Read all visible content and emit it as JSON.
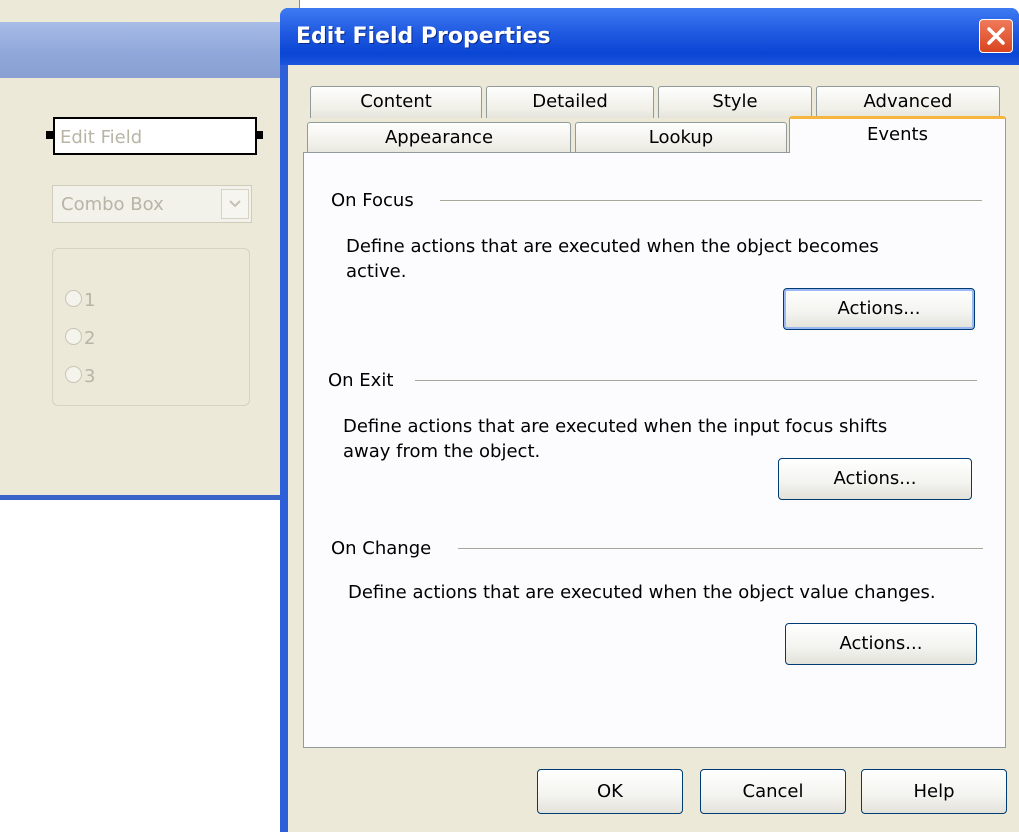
{
  "background_window": {
    "edit_field_label": "Edit Field",
    "combo_box_label": "Combo Box",
    "radio_options": [
      "1",
      "2",
      "3"
    ]
  },
  "dialog": {
    "title": "Edit Field Properties",
    "close_icon": "close-icon",
    "tabs_back_row": [
      "Content",
      "Detailed",
      "Style",
      "Advanced"
    ],
    "tabs_front_row": [
      "Appearance",
      "Lookup",
      "Events"
    ],
    "active_tab": "Events",
    "sections": [
      {
        "title": "On Focus",
        "description_line1": "Define actions that are executed when the object becomes",
        "description_line2": "active.",
        "button_label": "Actions..."
      },
      {
        "title": "On Exit",
        "description_line1": "Define actions that are executed when the input focus shifts",
        "description_line2": "away from the object.",
        "button_label": "Actions..."
      },
      {
        "title": "On Change",
        "description_line1": "Define actions that are executed when the object value changes.",
        "description_line2": "",
        "button_label": "Actions..."
      }
    ],
    "footer": {
      "ok_label": "OK",
      "cancel_label": "Cancel",
      "help_label": "Help"
    }
  },
  "colors": {
    "title_bar": "#0a46d4",
    "dialog_face": "#ece9d8",
    "active_tab_accent": "#f5b53f",
    "close_button": "#d8451f"
  }
}
